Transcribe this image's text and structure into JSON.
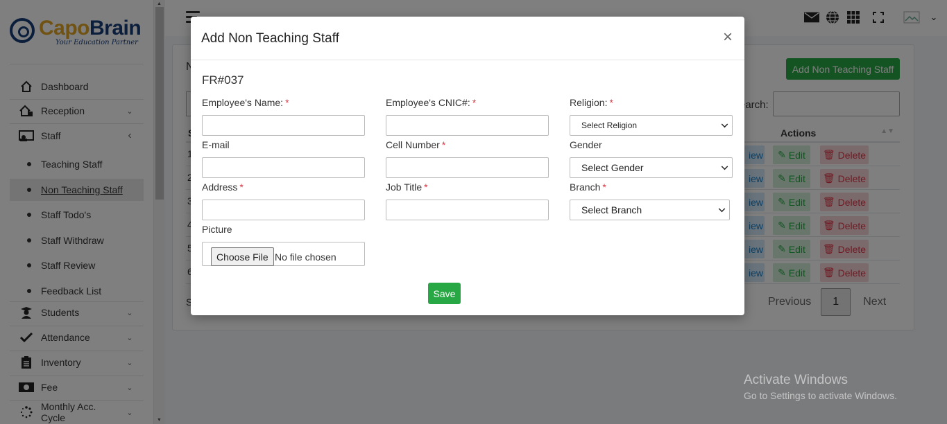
{
  "brand": {
    "name_part1": "Capo",
    "name_part2": "Brain",
    "tagline": "Your Education Partner"
  },
  "sidebar": {
    "items": [
      {
        "label": "Dashboard",
        "icon": "home-icon"
      },
      {
        "label": "Reception",
        "icon": "reception-icon",
        "chevron": "⌄"
      },
      {
        "label": "Staff",
        "icon": "staff-icon",
        "chevron": "‹"
      },
      {
        "label": "Students",
        "icon": "graduate-icon",
        "chevron": "⌄"
      },
      {
        "label": "Attendance",
        "icon": "check-icon",
        "chevron": "⌄"
      },
      {
        "label": "Inventory",
        "icon": "clipboard-icon",
        "chevron": "⌄"
      },
      {
        "label": "Fee",
        "icon": "money-icon",
        "chevron": "⌄"
      },
      {
        "label": "Monthly Acc. Cycle",
        "icon": "spinner-icon",
        "chevron": "⌄"
      }
    ],
    "staff_sub": [
      {
        "label": "Teaching Staff"
      },
      {
        "label": "Non Teaching Staff",
        "active": true
      },
      {
        "label": "Staff Todo's"
      },
      {
        "label": "Staff Withdraw"
      },
      {
        "label": "Staff Review"
      },
      {
        "label": "Feedback List"
      }
    ]
  },
  "page": {
    "add_button": "Add Non Teaching Staff",
    "search_label": "earch:",
    "heading_fragment": "N",
    "col_fragment": "S",
    "actions_header": "Actions",
    "row_nums": [
      "1",
      "2",
      "3",
      "4",
      "5",
      "6"
    ],
    "view_label": "iew",
    "edit_label": "Edit",
    "delete_label": "Delete",
    "showing_fragment": "S",
    "pager": {
      "prev": "Previous",
      "page": "1",
      "next": "Next"
    }
  },
  "modal": {
    "title": "Add Non Teaching Staff",
    "close": "×",
    "form_no": "FR#037",
    "fields": {
      "employee_name": "Employee's Name:",
      "employee_cnic": "Employee's CNIC#:",
      "religion": "Religion:",
      "email": "E-mail",
      "cell": "Cell Number",
      "gender": "Gender",
      "address": "Address",
      "job_title": "Job Title",
      "branch": "Branch",
      "picture": "Picture"
    },
    "required_mark": "*",
    "selects": {
      "religion": "Select Religion",
      "gender": "Select Gender",
      "branch": "Select Branch"
    },
    "file": {
      "button": "Choose File",
      "status": "No file chosen"
    },
    "save": "Save"
  },
  "watermark": {
    "line1": "Activate Windows",
    "line2": "Go to Settings to activate Windows."
  },
  "colors": {
    "primary_green": "#28a745",
    "brand_blue": "#163c79",
    "brand_gold": "#e0a526",
    "danger": "#dc3545"
  }
}
